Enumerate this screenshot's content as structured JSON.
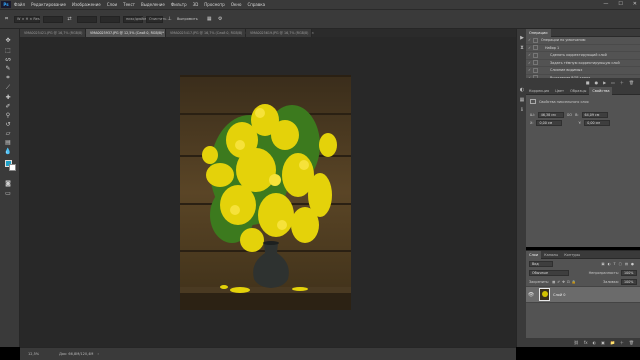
{
  "menu": {
    "logo": "Ps",
    "items": [
      "Файл",
      "Редактирование",
      "Изображение",
      "Слои",
      "Текст",
      "Выделение",
      "Фильтр",
      "3D",
      "Просмотр",
      "Окно",
      "Справка"
    ],
    "minimize": "—",
    "maximize": "☐",
    "close": "✕"
  },
  "options": {
    "size": "W × H × Res",
    "field1": "",
    "field2": "",
    "field3": "",
    "unit": "пикс/дюйм",
    "clear": "Очистить",
    "straighten": "Выпрямить"
  },
  "tabs": [
    {
      "label": "VMA0025421.JPG @ 16,7% (RGB/8)",
      "active": false
    },
    {
      "label": "VMA0025937.JPG @ 12,5% (Слой 0, RGB/8)*",
      "active": true
    },
    {
      "label": "VMA0025417.JPG @ 16,7% (Слой 0, RGB/8)",
      "active": false
    },
    {
      "label": "VMA0025619.JPG @ 16,7% (RGB/8)",
      "active": false
    }
  ],
  "status": {
    "zoom": "12,5%",
    "doc": "Док: 66,8M/120,4M"
  },
  "history": {
    "tabs": [
      "Операции"
    ],
    "title": "Операции",
    "items": [
      {
        "label": "Операции по умолчанию",
        "indent": 0
      },
      {
        "label": "Набор 1",
        "indent": 1
      },
      {
        "label": "Сделать корректирующий слой",
        "indent": 2
      },
      {
        "label": "Задать тёмную корректирующую слой",
        "indent": 2
      },
      {
        "label": "Слияние видимых",
        "indent": 2
      },
      {
        "label": "Выделение RGB канал",
        "indent": 2
      }
    ]
  },
  "properties": {
    "tabs": [
      "Коррекция",
      "Цвет",
      "Образцы",
      "Свойства"
    ],
    "active_tab": "Свойства",
    "section": "Свойства пиксельного слоя",
    "w": "46,38 см",
    "h": "64,09 см",
    "x": "0,00 см",
    "y": "0,00 см",
    "link": "GO"
  },
  "layers": {
    "tabs": [
      "Слои",
      "Каналы",
      "Контуры"
    ],
    "filter": "Вид",
    "blend": "Обычные",
    "opacity_label": "Непрозрачность:",
    "opacity": "100%",
    "lock_label": "Закрепить:",
    "fill_label": "Заливка:",
    "fill": "100%",
    "layer_name": "Слой 0",
    "footer": [
      "fx",
      "◐",
      "▣",
      "📁",
      "＋",
      "🗑"
    ]
  }
}
